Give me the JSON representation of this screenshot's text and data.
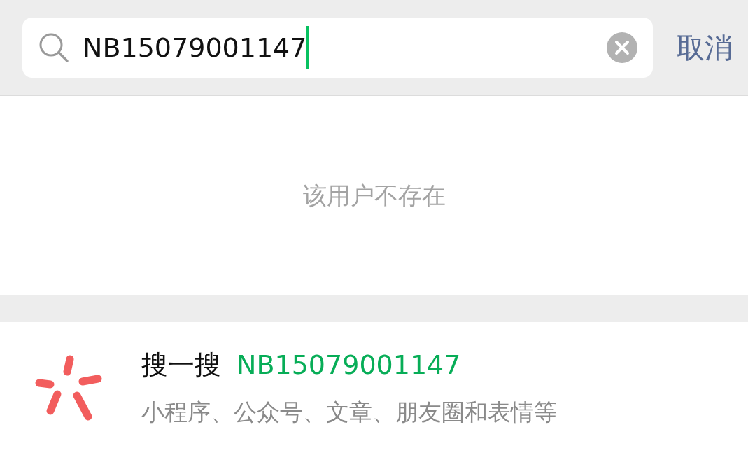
{
  "search": {
    "value": "NB15079001147"
  },
  "cancel_button": "取消",
  "message": "该用户不存在",
  "suggestion": {
    "title": "搜一搜",
    "query": "NB15079001147",
    "subtitle": "小程序、公众号、文章、朋友圈和表情等"
  }
}
